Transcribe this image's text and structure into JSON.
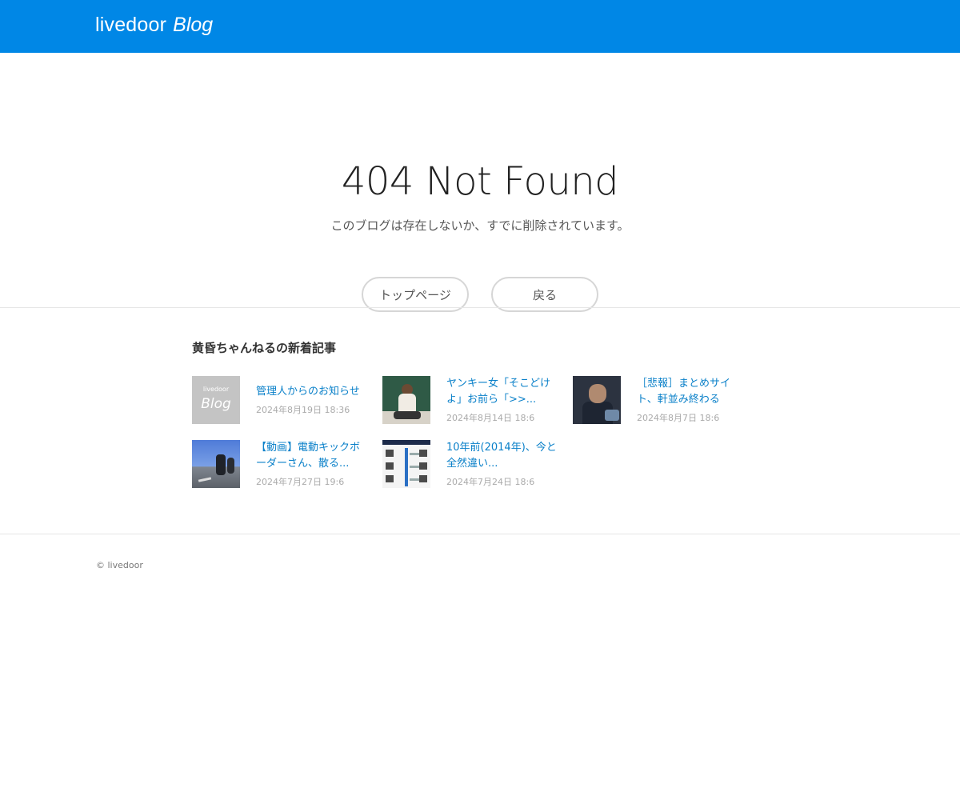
{
  "header": {
    "logo_main": "livedoor",
    "logo_sub": "Blog"
  },
  "error": {
    "title": "404 Not Found",
    "message": "このブログは存在しないか、すでに削除されています。",
    "top_button": "トップページ",
    "back_button": "戻る"
  },
  "recent": {
    "heading": "黄昏ちゃんねるの新着記事",
    "items": [
      {
        "title": "管理人からのお知らせ",
        "date": "2024年8月19日 18:36",
        "thumb_small": "livedoor",
        "thumb_big": "Blog"
      },
      {
        "title": "ヤンキー女「そこどけよ」お前ら「>>...",
        "date": "2024年8月14日 18:6"
      },
      {
        "title": "［悲報］まとめサイト、軒並み終わる",
        "date": "2024年8月7日 18:6"
      },
      {
        "title": "【動画】電動キックボーダーさん、散る...",
        "date": "2024年7月27日 19:6"
      },
      {
        "title": "10年前(2014年)、今と全然違い...",
        "date": "2024年7月24日 18:6"
      }
    ]
  },
  "footer": {
    "copyright": "© livedoor"
  },
  "colors": {
    "brand": "#0087e6",
    "link": "#0a80c9"
  }
}
